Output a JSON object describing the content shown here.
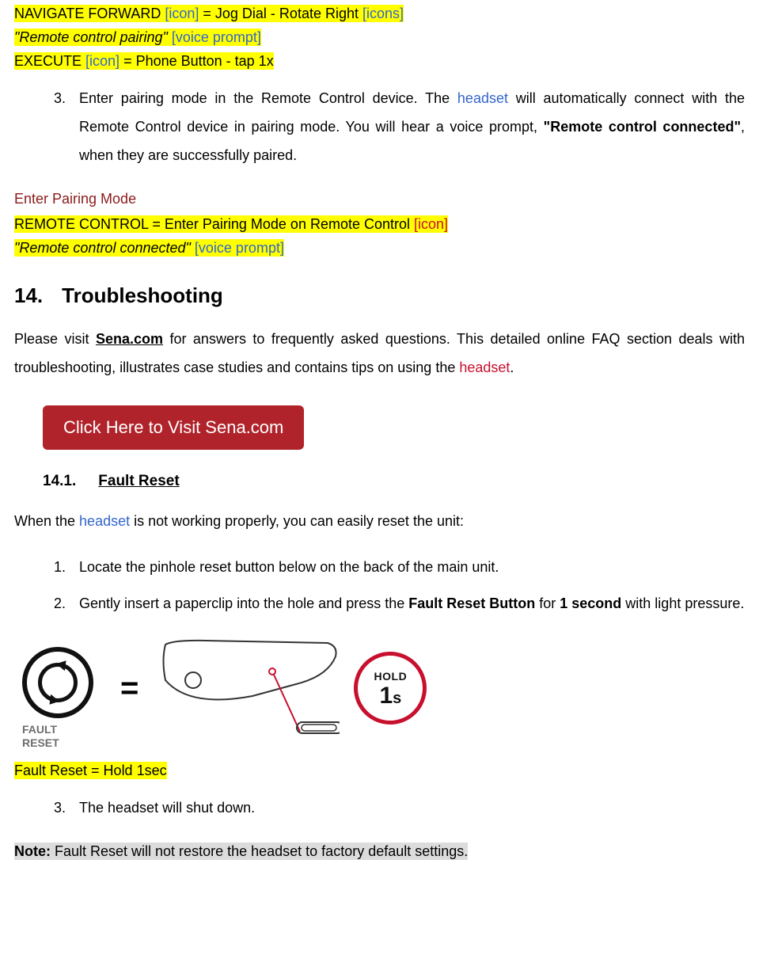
{
  "intro": {
    "line1": {
      "text": "NAVIGATE FORWARD ",
      "icon1": "[icon]",
      "mid": " = Jog Dial - Rotate Right ",
      "icon2": "[icons]"
    },
    "line2_prompt": "\"Remote control pairing\" ",
    "voice_prompt_tag": "[voice prompt]",
    "line3": {
      "text": "EXECUTE ",
      "icon": "[icon]",
      "tail": " = Phone Button - tap 1x"
    }
  },
  "step3": {
    "pre": "Enter pairing mode in the Remote Control device. The ",
    "headset": "headset",
    "mid1": " will automatically connect with the Remote Control device in pairing mode. You will hear a voice prompt, ",
    "bold_prompt": "\"Remote control connected\"",
    "tail": ", when they are successfully paired."
  },
  "enter_pairing_title": "Enter Pairing Mode",
  "enter_pairing_line": {
    "text": "REMOTE CONTROL = Enter Pairing Mode on Remote Control ",
    "icon": "[icon]"
  },
  "connected_prompt": "\"Remote control connected\" ",
  "section14": {
    "num": "14.",
    "title": "Troubleshooting"
  },
  "s14_para": {
    "pre": "Please visit ",
    "sena_link": "Sena.com",
    "mid": " for answers to frequently asked questions. This detailed online FAQ section deals with troubleshooting, illustrates case studies and contains tips on using the ",
    "headset": "headset",
    "tail": "."
  },
  "visit_button": "Click Here to Visit Sena.com",
  "sub14_1": {
    "num": "14.1.",
    "title": "Fault Reset"
  },
  "fault_intro": {
    "pre": "When the ",
    "headset": "headset",
    "tail": " is not working properly, you can easily reset the unit:"
  },
  "fault_steps": {
    "s1": "Locate the pinhole reset button below on the back of the main unit.",
    "s2_pre": "Gently insert a paperclip into the hole and press the ",
    "s2_b1": "Fault Reset Button",
    "s2_mid": " for ",
    "s2_b2": "1 second",
    "s2_tail": " with light pressure.",
    "s3": "The headset will shut down."
  },
  "diagram": {
    "reset_label": "FAULT\nRESET",
    "equals": "=",
    "hold_top": "HOLD",
    "hold_big": "1",
    "hold_unit": "s"
  },
  "fault_hl": "Fault Reset = Hold 1sec",
  "note": {
    "label": "Note:",
    "text": " Fault Reset will not restore the headset to factory default settings."
  }
}
